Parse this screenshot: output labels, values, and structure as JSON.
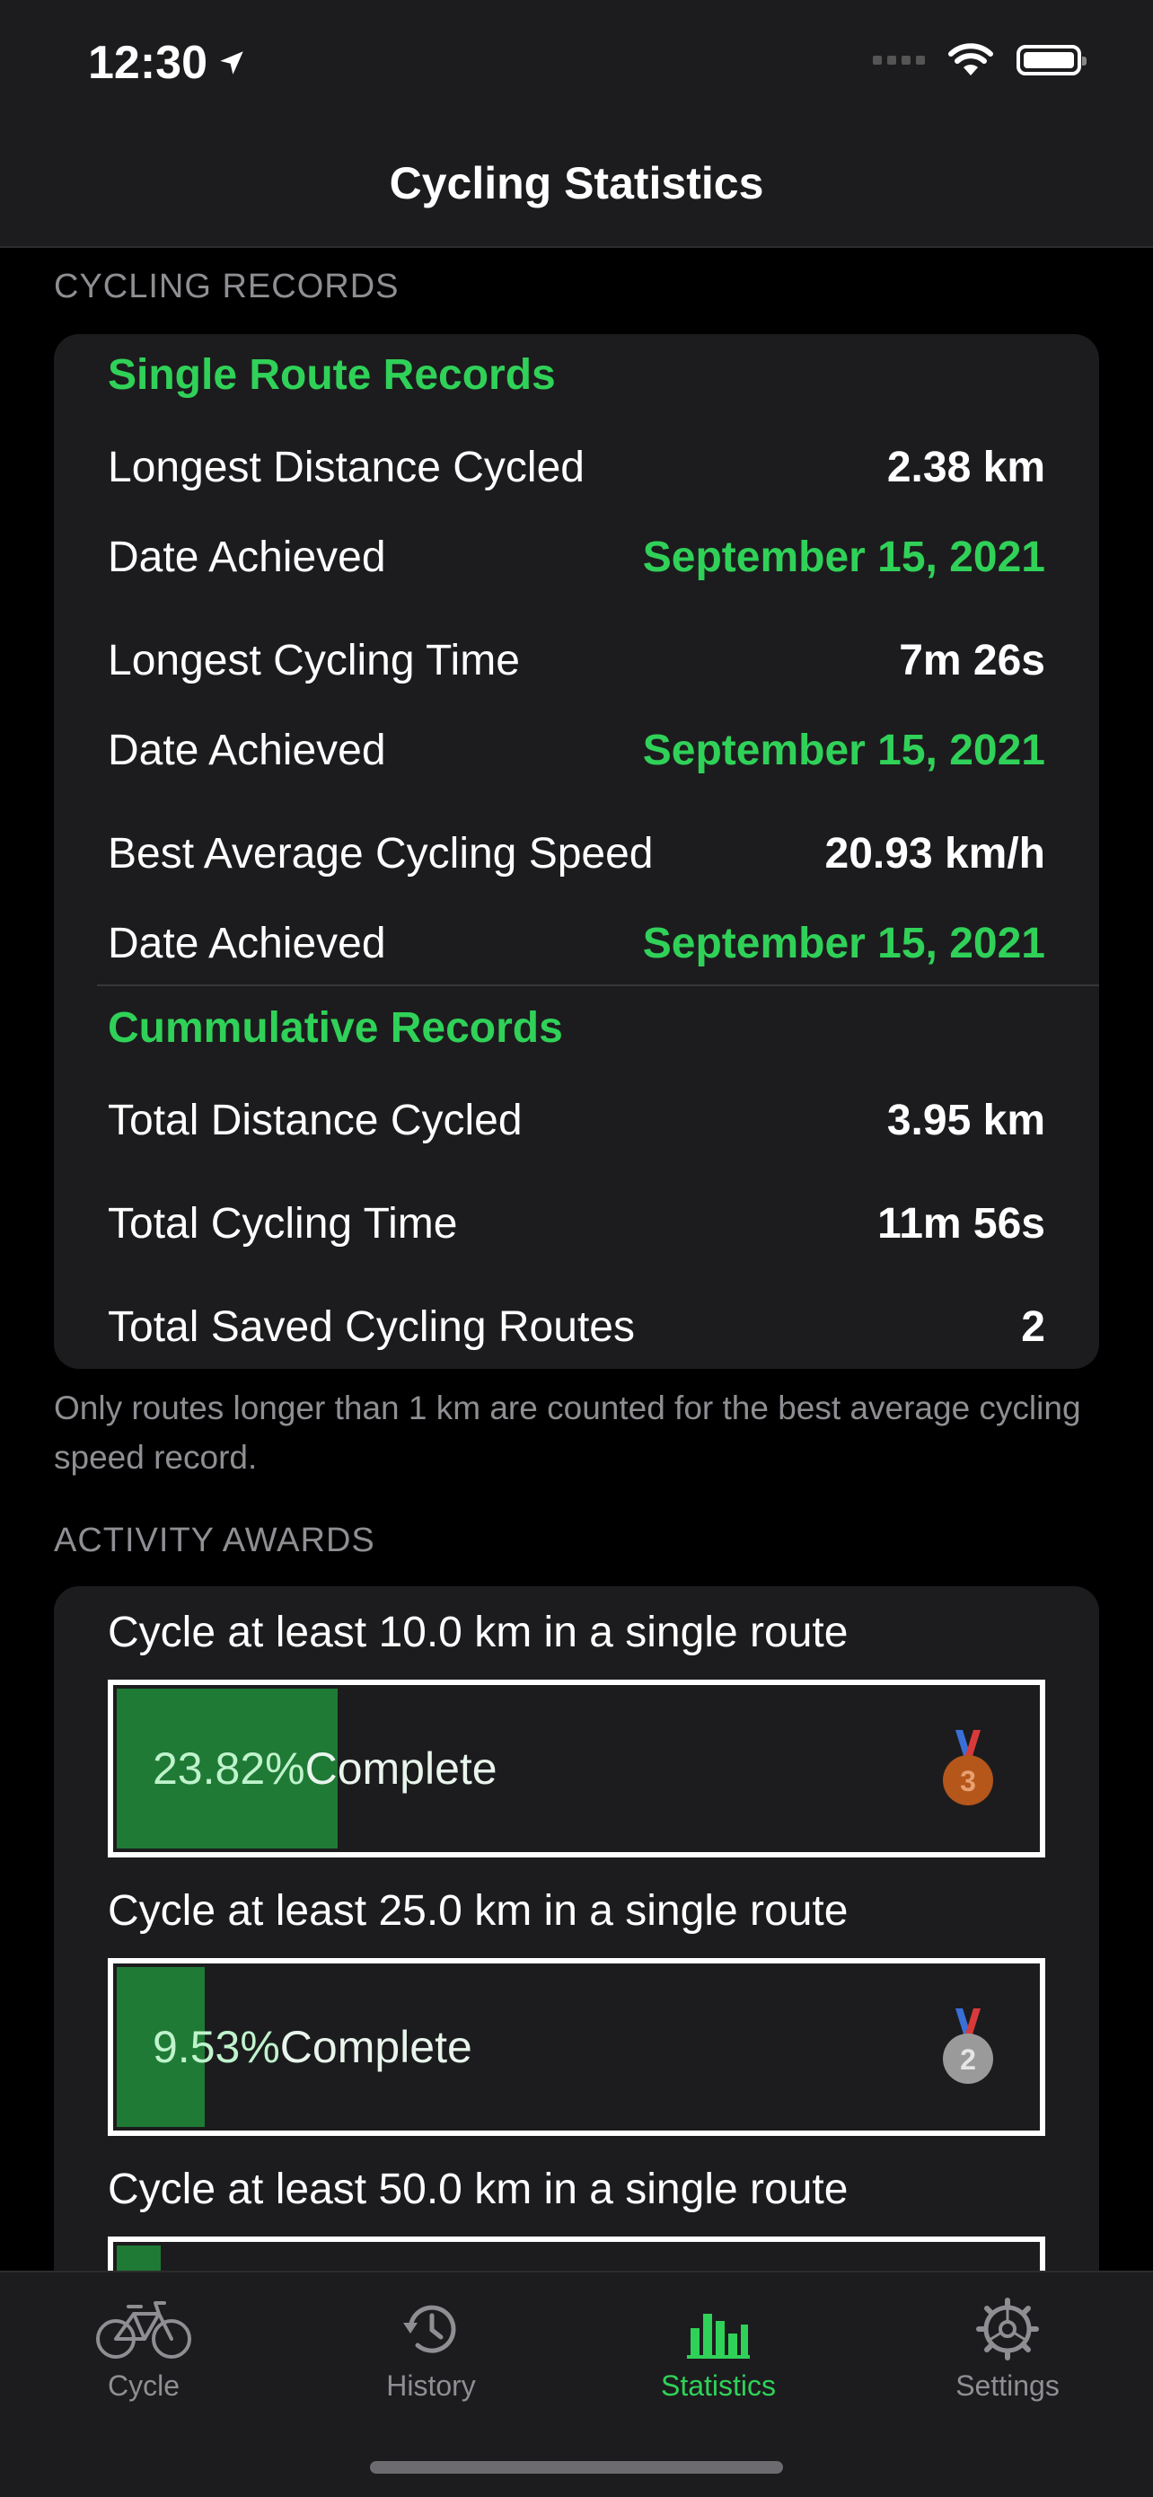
{
  "status_bar": {
    "time": "12:30"
  },
  "nav": {
    "title": "Cycling Statistics"
  },
  "records": {
    "section_header": "CYCLING RECORDS",
    "single_route_title": "Single Route Records",
    "rows": [
      {
        "label": "Longest Distance Cycled",
        "value": "2.38 km"
      },
      {
        "label": "Date Achieved",
        "value": "September 15, 2021"
      },
      {
        "label": "Longest Cycling Time",
        "value": "7m 26s"
      },
      {
        "label": "Date Achieved",
        "value": "September 15, 2021"
      },
      {
        "label": "Best Average Cycling Speed",
        "value": "20.93 km/h"
      },
      {
        "label": "Date Achieved",
        "value": "September 15, 2021"
      }
    ],
    "cumulative_title": "Cummulative Records",
    "cumulative_rows": [
      {
        "label": "Total Distance Cycled",
        "value": "3.95 km"
      },
      {
        "label": "Total Cycling Time",
        "value": "11m 56s"
      },
      {
        "label": "Total Saved Cycling Routes",
        "value": "2"
      }
    ],
    "footnote": "Only routes longer than 1 km are counted for the best average cycling speed record."
  },
  "awards": {
    "section_header": "ACTIVITY AWARDS",
    "items": [
      {
        "label": "Cycle at least 10.0 km in a single route",
        "percent_text": "23.82%",
        "suffix": " Complete",
        "progress": 0.2382,
        "medal": "3",
        "medal_color": "#b5561b"
      },
      {
        "label": "Cycle at least 25.0 km in a single route",
        "percent_text": "9.53%",
        "suffix": " Complete",
        "progress": 0.0953,
        "medal": "2",
        "medal_color": "#9a9a9a"
      },
      {
        "label": "Cycle at least 50.0 km in a single route",
        "percent_text": "",
        "suffix": "",
        "progress": 0.0476,
        "medal": "",
        "medal_color": "#d4a017"
      }
    ]
  },
  "tabbar": {
    "tabs": [
      {
        "label": "Cycle",
        "icon": "bicycle-icon",
        "active": false
      },
      {
        "label": "History",
        "icon": "history-clock-icon",
        "active": false
      },
      {
        "label": "Statistics",
        "icon": "bar-chart-icon",
        "active": true
      },
      {
        "label": "Settings",
        "icon": "gear-icon",
        "active": false
      }
    ]
  },
  "colors": {
    "accent": "#30d158",
    "progress_fill": "#1f7a35",
    "card": "#1c1c1e",
    "secondary_text": "#8e8e93"
  }
}
